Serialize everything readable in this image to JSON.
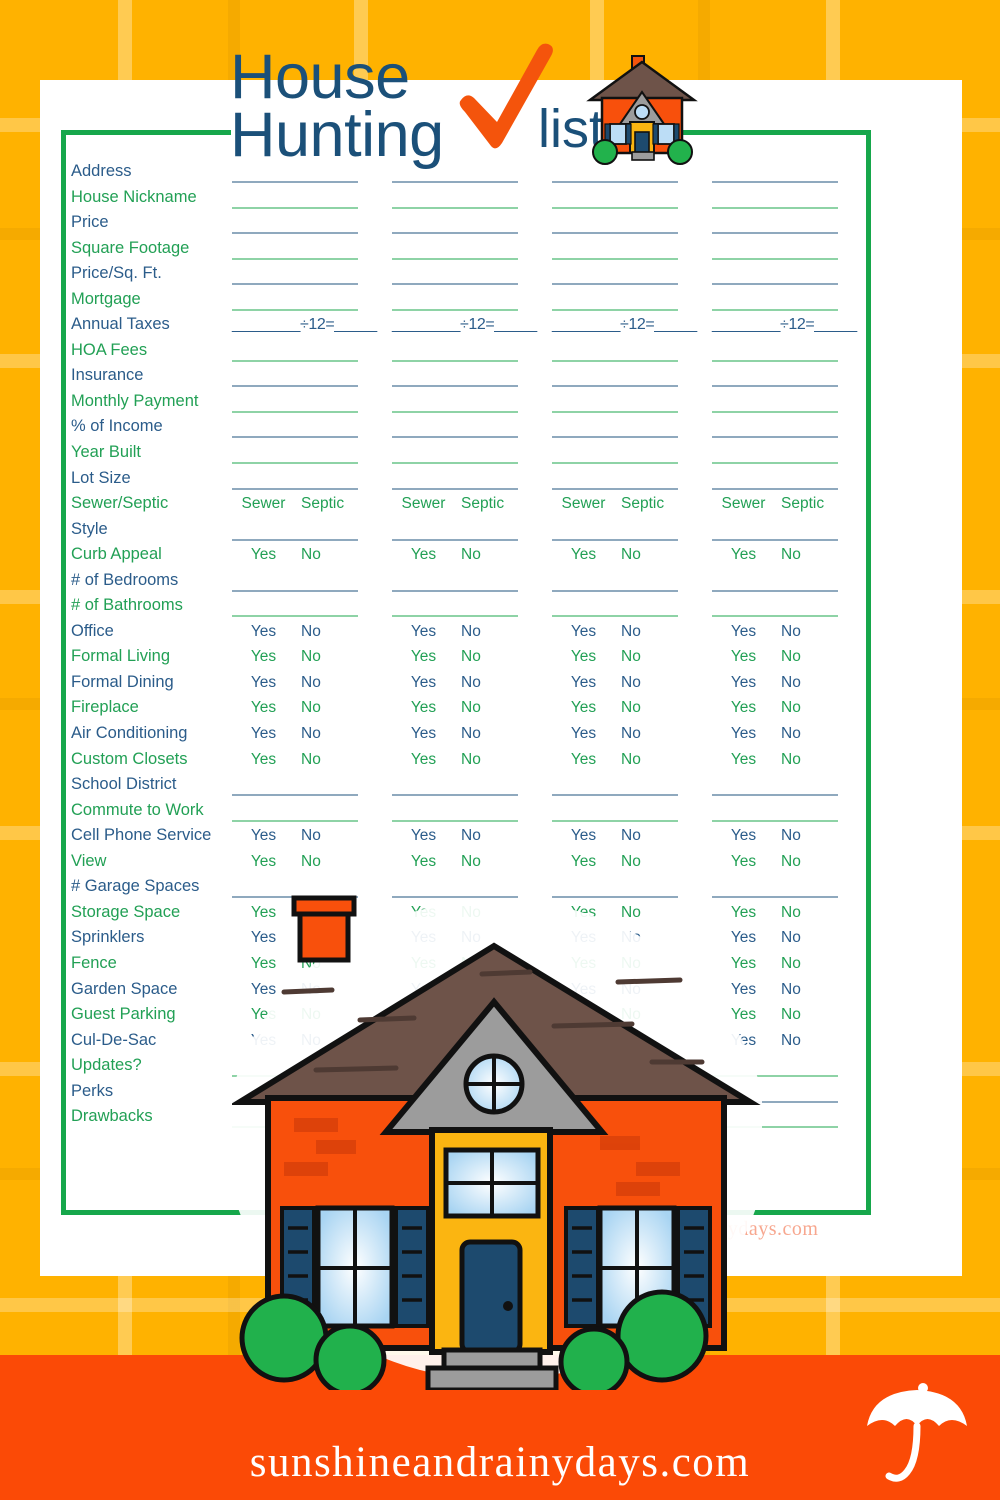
{
  "header": {
    "title_line_1": "House",
    "title_line_2": "Hunting",
    "title_list_word": "list",
    "check_icon": "orange-check-mark",
    "house_icon": "small-house-illustration"
  },
  "footer": {
    "url": "sunshineandrainydays.com",
    "logo": "umbrella-logo",
    "logo_text": "Sunshine and Rainy Days"
  },
  "watermark": {
    "text": "eandrainydays.com"
  },
  "colors": {
    "blue": "#2B5C8A",
    "green": "#22A055",
    "frame_green": "#16A74B",
    "title_blue": "#1B5079",
    "check_orange": "#F4540C",
    "band_orange": "#FB4A06",
    "plaid_yellow": "#FFB200",
    "line_blue": "#8FA9BE",
    "line_green": "#8ED3A6",
    "watermark_orange": "#F58A6A"
  },
  "table": {
    "column_count": 4,
    "tax_formula": "________÷12=_____",
    "sewer_label": "Sewer",
    "septic_label": "Septic",
    "yes_label": "Yes",
    "no_label": "No",
    "rows": [
      {
        "label": "Address",
        "color": "blue",
        "type": "line"
      },
      {
        "label": "House Nickname",
        "color": "green",
        "type": "line"
      },
      {
        "label": "Price",
        "color": "blue",
        "type": "line"
      },
      {
        "label": "Square Footage",
        "color": "green",
        "type": "line"
      },
      {
        "label": "Price/Sq. Ft.",
        "color": "blue",
        "type": "line"
      },
      {
        "label": "Mortgage",
        "color": "green",
        "type": "line"
      },
      {
        "label": "Annual Taxes",
        "color": "blue",
        "type": "tax"
      },
      {
        "label": "HOA Fees",
        "color": "green",
        "type": "line"
      },
      {
        "label": "Insurance",
        "color": "blue",
        "type": "line"
      },
      {
        "label": "Monthly Payment",
        "color": "green",
        "type": "line"
      },
      {
        "label": "% of Income",
        "color": "blue",
        "type": "line"
      },
      {
        "label": "Year Built",
        "color": "green",
        "type": "line"
      },
      {
        "label": "Lot Size",
        "color": "blue",
        "type": "line"
      },
      {
        "label": "Sewer/Septic",
        "color": "green",
        "type": "sewer"
      },
      {
        "label": "Style",
        "color": "blue",
        "type": "line"
      },
      {
        "label": "Curb Appeal",
        "color": "green",
        "type": "yesno"
      },
      {
        "label": "# of Bedrooms",
        "color": "blue",
        "type": "line"
      },
      {
        "label": "# of Bathrooms",
        "color": "green",
        "type": "line"
      },
      {
        "label": "Office",
        "color": "blue",
        "type": "yesno"
      },
      {
        "label": "Formal Living",
        "color": "green",
        "type": "yesno"
      },
      {
        "label": "Formal Dining",
        "color": "blue",
        "type": "yesno"
      },
      {
        "label": "Fireplace",
        "color": "green",
        "type": "yesno"
      },
      {
        "label": "Air Conditioning",
        "color": "blue",
        "type": "yesno"
      },
      {
        "label": "Custom Closets",
        "color": "green",
        "type": "yesno"
      },
      {
        "label": "School District",
        "color": "blue",
        "type": "line"
      },
      {
        "label": "Commute to Work",
        "color": "green",
        "type": "line"
      },
      {
        "label": "Cell Phone Service",
        "color": "blue",
        "type": "yesno"
      },
      {
        "label": "View",
        "color": "green",
        "type": "yesno"
      },
      {
        "label": "# Garage Spaces",
        "color": "blue",
        "type": "line"
      },
      {
        "label": "Storage Space",
        "color": "green",
        "type": "yesno"
      },
      {
        "label": "Sprinklers",
        "color": "blue",
        "type": "yesno"
      },
      {
        "label": "Fence",
        "color": "green",
        "type": "yesno"
      },
      {
        "label": "Garden Space",
        "color": "blue",
        "type": "yesno"
      },
      {
        "label": "Guest Parking",
        "color": "green",
        "type": "yesno"
      },
      {
        "label": "Cul-De-Sac",
        "color": "blue",
        "type": "yesno"
      },
      {
        "label": "Updates?",
        "color": "green",
        "type": "line"
      },
      {
        "label": "Perks",
        "color": "blue",
        "type": "line"
      },
      {
        "label": "Drawbacks",
        "color": "green",
        "type": "line"
      }
    ]
  }
}
